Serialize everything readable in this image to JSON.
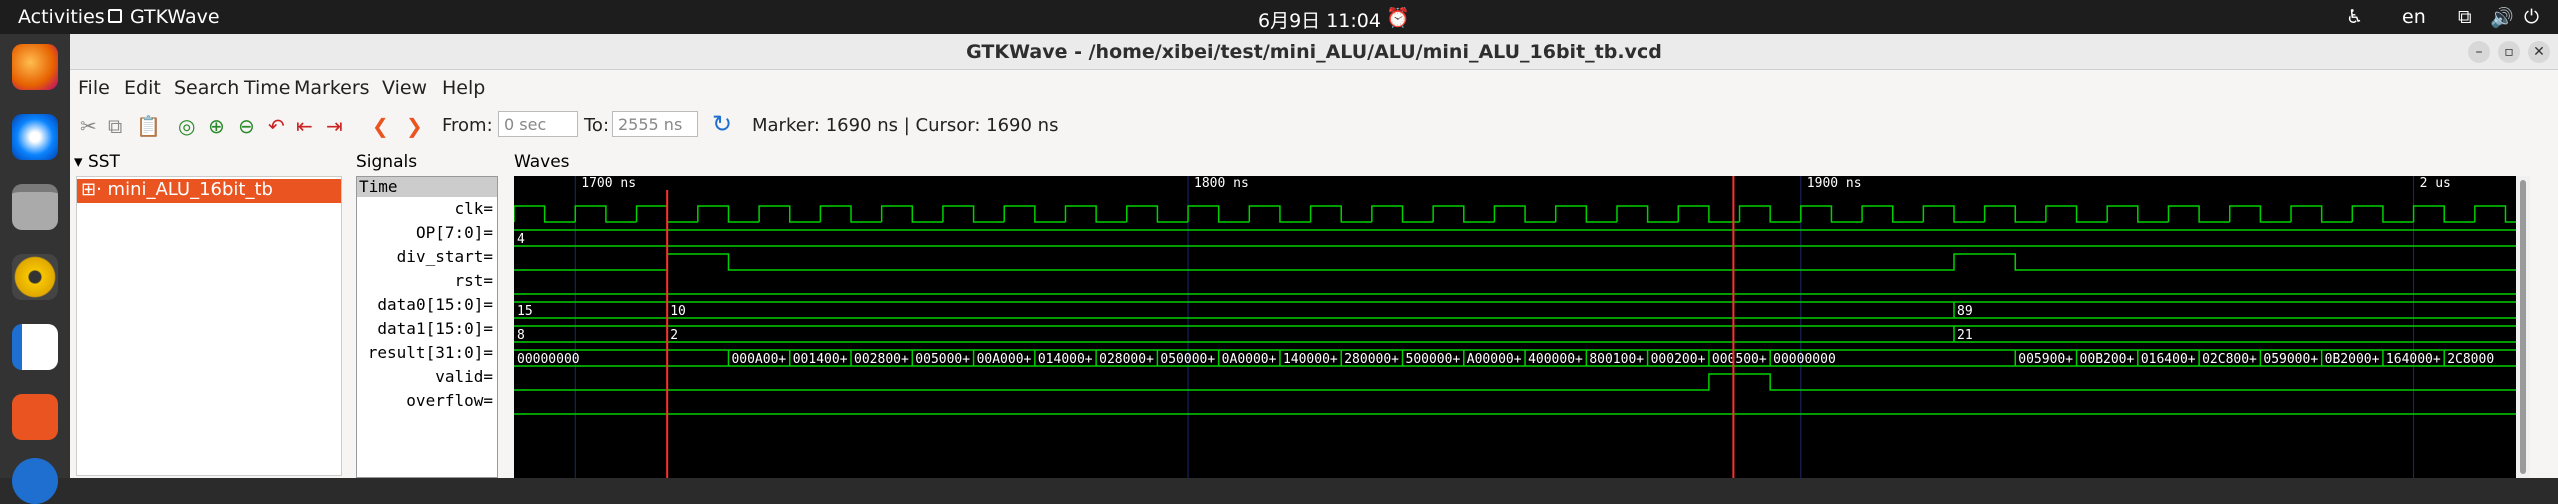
{
  "system": {
    "activities": "Activities",
    "app": "GTKWave",
    "clock": "6月9日  11:04",
    "lang": "en"
  },
  "window": {
    "title": "GTKWave - /home/xibei/test/mini_ALU/ALU/mini_ALU_16bit_tb.vcd"
  },
  "menu": [
    "File",
    "Edit",
    "Search",
    "Time",
    "Markers",
    "View",
    "Help"
  ],
  "toolbar": {
    "from_label": "From:",
    "from_value": "0 sec",
    "to_label": "To:",
    "to_value": "2555 ns",
    "marker_text": "Marker: 1690 ns  |  Cursor: 1690 ns"
  },
  "sst": {
    "title": "SST",
    "item": "mini_ALU_16bit_tb"
  },
  "signals": {
    "title": "Signals",
    "header": "Time",
    "list": [
      "clk=",
      "OP[7:0]=",
      "div_start=",
      "rst=",
      "data0[15:0]=",
      "data1[15:0]=",
      "result[31:0]=",
      "valid=",
      "overflow="
    ]
  },
  "waves": {
    "title": "Waves",
    "time_labels": [
      {
        "t": 1700,
        "label": "1700 ns"
      },
      {
        "t": 1800,
        "label": "1800 ns"
      },
      {
        "t": 1900,
        "label": "1900 ns"
      },
      {
        "t": 2000,
        "label": "2 us"
      }
    ],
    "view_start_ns": 1690,
    "view_end_ns": 2019,
    "marker_ns": 1715,
    "cursor_ns": 1889,
    "clk_period_ns": 10,
    "op_value": "4",
    "div_start_pulses": [
      [
        1715,
        1725
      ],
      [
        1925,
        1935
      ]
    ],
    "data0": [
      {
        "t": 1690,
        "v": "15"
      },
      {
        "t": 1715,
        "v": "10"
      },
      {
        "t": 1925,
        "v": "89"
      }
    ],
    "data1": [
      {
        "t": 1690,
        "v": "8"
      },
      {
        "t": 1715,
        "v": "2"
      },
      {
        "t": 1925,
        "v": "21"
      }
    ],
    "result": [
      {
        "t": 1690,
        "v": "00000000"
      },
      {
        "t": 1725,
        "v": "000A00+"
      },
      {
        "t": 1735,
        "v": "001400+"
      },
      {
        "t": 1745,
        "v": "002800+"
      },
      {
        "t": 1755,
        "v": "005000+"
      },
      {
        "t": 1765,
        "v": "00A000+"
      },
      {
        "t": 1775,
        "v": "014000+"
      },
      {
        "t": 1785,
        "v": "028000+"
      },
      {
        "t": 1795,
        "v": "050000+"
      },
      {
        "t": 1805,
        "v": "0A0000+"
      },
      {
        "t": 1815,
        "v": "140000+"
      },
      {
        "t": 1825,
        "v": "280000+"
      },
      {
        "t": 1835,
        "v": "500000+"
      },
      {
        "t": 1845,
        "v": "A00000+"
      },
      {
        "t": 1855,
        "v": "400000+"
      },
      {
        "t": 1865,
        "v": "800100+"
      },
      {
        "t": 1875,
        "v": "000200+"
      },
      {
        "t": 1885,
        "v": "000500+"
      },
      {
        "t": 1895,
        "v": "00000000"
      },
      {
        "t": 1935,
        "v": "005900+"
      },
      {
        "t": 1945,
        "v": "00B200+"
      },
      {
        "t": 1955,
        "v": "016400+"
      },
      {
        "t": 1965,
        "v": "02C800+"
      },
      {
        "t": 1975,
        "v": "059000+"
      },
      {
        "t": 1985,
        "v": "0B2000+"
      },
      {
        "t": 1995,
        "v": "164000+"
      },
      {
        "t": 2005,
        "v": "2C8000"
      }
    ],
    "valid_pulses": [
      [
        1885,
        1895
      ]
    ]
  }
}
